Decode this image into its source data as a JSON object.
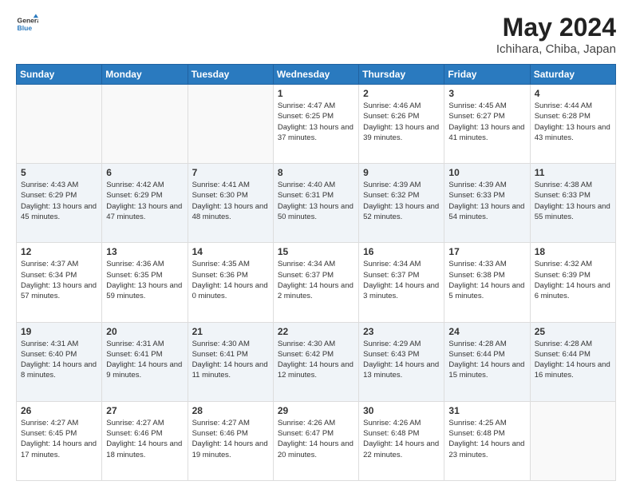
{
  "header": {
    "logo_line1": "General",
    "logo_line2": "Blue",
    "title": "May 2024",
    "subtitle": "Ichihara, Chiba, Japan"
  },
  "days_of_week": [
    "Sunday",
    "Monday",
    "Tuesday",
    "Wednesday",
    "Thursday",
    "Friday",
    "Saturday"
  ],
  "weeks": [
    [
      {
        "day": "",
        "text": ""
      },
      {
        "day": "",
        "text": ""
      },
      {
        "day": "",
        "text": ""
      },
      {
        "day": "1",
        "text": "Sunrise: 4:47 AM\nSunset: 6:25 PM\nDaylight: 13 hours and 37 minutes."
      },
      {
        "day": "2",
        "text": "Sunrise: 4:46 AM\nSunset: 6:26 PM\nDaylight: 13 hours and 39 minutes."
      },
      {
        "day": "3",
        "text": "Sunrise: 4:45 AM\nSunset: 6:27 PM\nDaylight: 13 hours and 41 minutes."
      },
      {
        "day": "4",
        "text": "Sunrise: 4:44 AM\nSunset: 6:28 PM\nDaylight: 13 hours and 43 minutes."
      }
    ],
    [
      {
        "day": "5",
        "text": "Sunrise: 4:43 AM\nSunset: 6:29 PM\nDaylight: 13 hours and 45 minutes."
      },
      {
        "day": "6",
        "text": "Sunrise: 4:42 AM\nSunset: 6:29 PM\nDaylight: 13 hours and 47 minutes."
      },
      {
        "day": "7",
        "text": "Sunrise: 4:41 AM\nSunset: 6:30 PM\nDaylight: 13 hours and 48 minutes."
      },
      {
        "day": "8",
        "text": "Sunrise: 4:40 AM\nSunset: 6:31 PM\nDaylight: 13 hours and 50 minutes."
      },
      {
        "day": "9",
        "text": "Sunrise: 4:39 AM\nSunset: 6:32 PM\nDaylight: 13 hours and 52 minutes."
      },
      {
        "day": "10",
        "text": "Sunrise: 4:39 AM\nSunset: 6:33 PM\nDaylight: 13 hours and 54 minutes."
      },
      {
        "day": "11",
        "text": "Sunrise: 4:38 AM\nSunset: 6:33 PM\nDaylight: 13 hours and 55 minutes."
      }
    ],
    [
      {
        "day": "12",
        "text": "Sunrise: 4:37 AM\nSunset: 6:34 PM\nDaylight: 13 hours and 57 minutes."
      },
      {
        "day": "13",
        "text": "Sunrise: 4:36 AM\nSunset: 6:35 PM\nDaylight: 13 hours and 59 minutes."
      },
      {
        "day": "14",
        "text": "Sunrise: 4:35 AM\nSunset: 6:36 PM\nDaylight: 14 hours and 0 minutes."
      },
      {
        "day": "15",
        "text": "Sunrise: 4:34 AM\nSunset: 6:37 PM\nDaylight: 14 hours and 2 minutes."
      },
      {
        "day": "16",
        "text": "Sunrise: 4:34 AM\nSunset: 6:37 PM\nDaylight: 14 hours and 3 minutes."
      },
      {
        "day": "17",
        "text": "Sunrise: 4:33 AM\nSunset: 6:38 PM\nDaylight: 14 hours and 5 minutes."
      },
      {
        "day": "18",
        "text": "Sunrise: 4:32 AM\nSunset: 6:39 PM\nDaylight: 14 hours and 6 minutes."
      }
    ],
    [
      {
        "day": "19",
        "text": "Sunrise: 4:31 AM\nSunset: 6:40 PM\nDaylight: 14 hours and 8 minutes."
      },
      {
        "day": "20",
        "text": "Sunrise: 4:31 AM\nSunset: 6:41 PM\nDaylight: 14 hours and 9 minutes."
      },
      {
        "day": "21",
        "text": "Sunrise: 4:30 AM\nSunset: 6:41 PM\nDaylight: 14 hours and 11 minutes."
      },
      {
        "day": "22",
        "text": "Sunrise: 4:30 AM\nSunset: 6:42 PM\nDaylight: 14 hours and 12 minutes."
      },
      {
        "day": "23",
        "text": "Sunrise: 4:29 AM\nSunset: 6:43 PM\nDaylight: 14 hours and 13 minutes."
      },
      {
        "day": "24",
        "text": "Sunrise: 4:28 AM\nSunset: 6:44 PM\nDaylight: 14 hours and 15 minutes."
      },
      {
        "day": "25",
        "text": "Sunrise: 4:28 AM\nSunset: 6:44 PM\nDaylight: 14 hours and 16 minutes."
      }
    ],
    [
      {
        "day": "26",
        "text": "Sunrise: 4:27 AM\nSunset: 6:45 PM\nDaylight: 14 hours and 17 minutes."
      },
      {
        "day": "27",
        "text": "Sunrise: 4:27 AM\nSunset: 6:46 PM\nDaylight: 14 hours and 18 minutes."
      },
      {
        "day": "28",
        "text": "Sunrise: 4:27 AM\nSunset: 6:46 PM\nDaylight: 14 hours and 19 minutes."
      },
      {
        "day": "29",
        "text": "Sunrise: 4:26 AM\nSunset: 6:47 PM\nDaylight: 14 hours and 20 minutes."
      },
      {
        "day": "30",
        "text": "Sunrise: 4:26 AM\nSunset: 6:48 PM\nDaylight: 14 hours and 22 minutes."
      },
      {
        "day": "31",
        "text": "Sunrise: 4:25 AM\nSunset: 6:48 PM\nDaylight: 14 hours and 23 minutes."
      },
      {
        "day": "",
        "text": ""
      }
    ]
  ]
}
